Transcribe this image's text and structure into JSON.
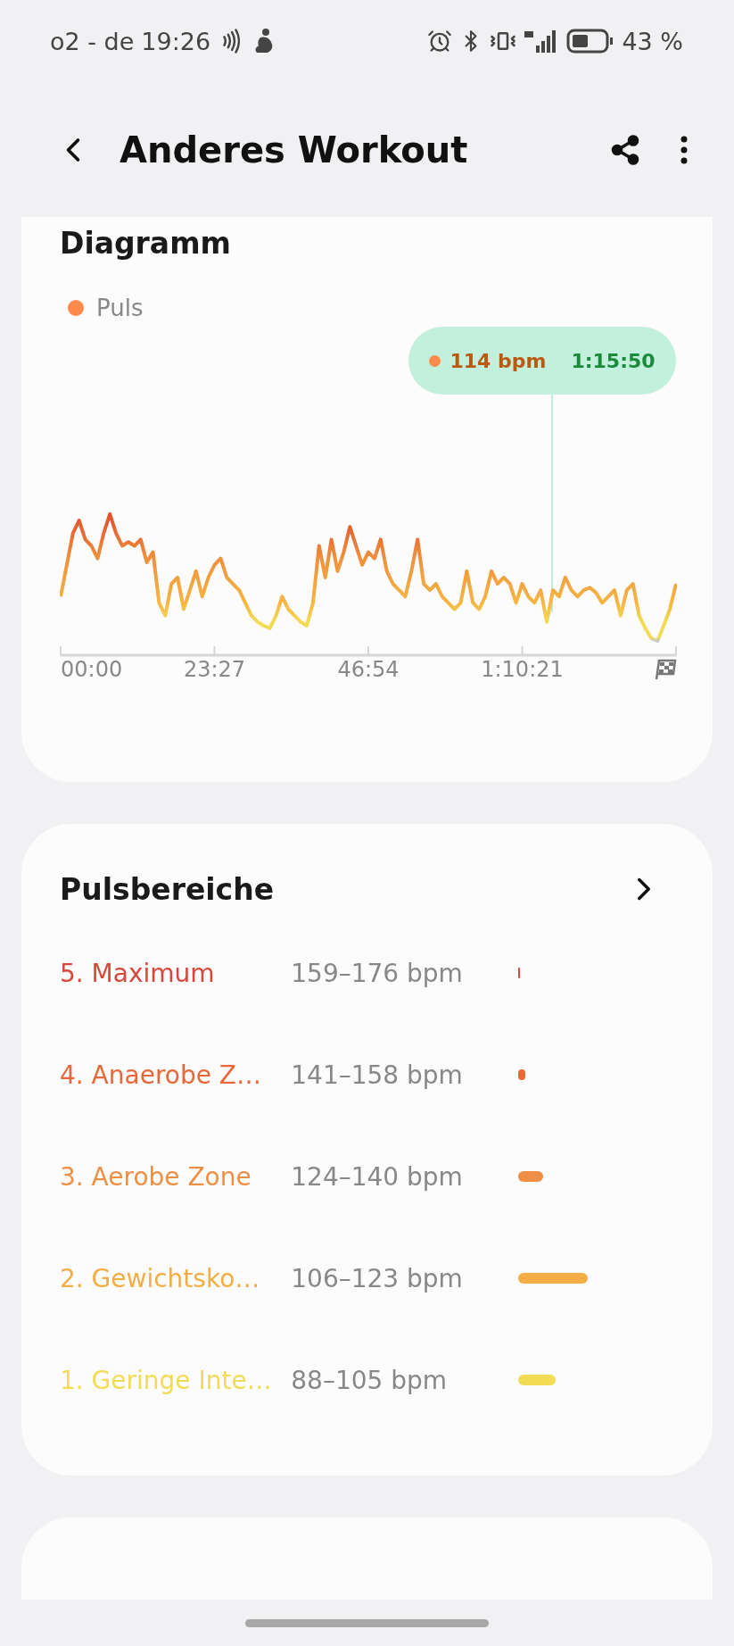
{
  "status_bar": {
    "carrier": "o2 - de",
    "time": "19:26",
    "battery": "43 %"
  },
  "header": {
    "title": "Anderes Workout"
  },
  "chart_card": {
    "title": "Diagramm",
    "legend": "Puls",
    "tooltip": {
      "value": "114 bpm",
      "time": "1:15:50"
    },
    "x_labels": [
      "00:00",
      "23:27",
      "46:54",
      "1:10:21"
    ]
  },
  "zones_card": {
    "title": "Pulsbereiche",
    "zones": [
      {
        "name": "5. Maximum",
        "range": "159–176 bpm",
        "color": "#d9473a"
      },
      {
        "name": "4. Anaerobe Z…",
        "range": "141–158 bpm",
        "color": "#e8683a"
      },
      {
        "name": "3. Aerobe Zone",
        "range": "124–140 bpm",
        "color": "#ee8f45"
      },
      {
        "name": "2. Gewichtsko…",
        "range": "106–123 bpm",
        "color": "#f4ad45"
      },
      {
        "name": "1. Geringe Inte…",
        "range": "88–105 bpm",
        "color": "#f3dc55"
      }
    ]
  }
}
